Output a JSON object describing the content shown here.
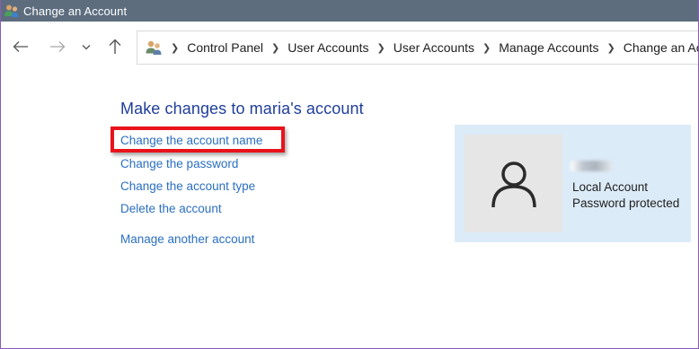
{
  "window": {
    "title": "Change an Account",
    "title_icon": "users-icon"
  },
  "navigation": {
    "back_icon": "back-arrow-icon",
    "forward_icon": "forward-arrow-icon",
    "recent_icon": "chevron-down-icon",
    "up_icon": "up-arrow-icon"
  },
  "breadcrumb": {
    "icon": "users-icon",
    "items": [
      "Control Panel",
      "User Accounts",
      "User Accounts",
      "Manage Accounts",
      "Change an Account"
    ]
  },
  "main": {
    "heading": "Make changes to maria's account",
    "tasks": [
      "Change the account name",
      "Change the password",
      "Change the account type",
      "Delete the account"
    ],
    "manage_link": "Manage another account",
    "highlighted_task_index": 0
  },
  "account": {
    "avatar_icon": "user-avatar-icon",
    "account_type": "Local Account",
    "password_status": "Password protected"
  },
  "colors": {
    "titlebar": "#5d6d7e",
    "heading": "#1f3e99",
    "link": "#2a6fbf",
    "highlight": "#e8131b",
    "account_panel": "#dcebf8",
    "avatar_tile": "#e6e6e6"
  }
}
